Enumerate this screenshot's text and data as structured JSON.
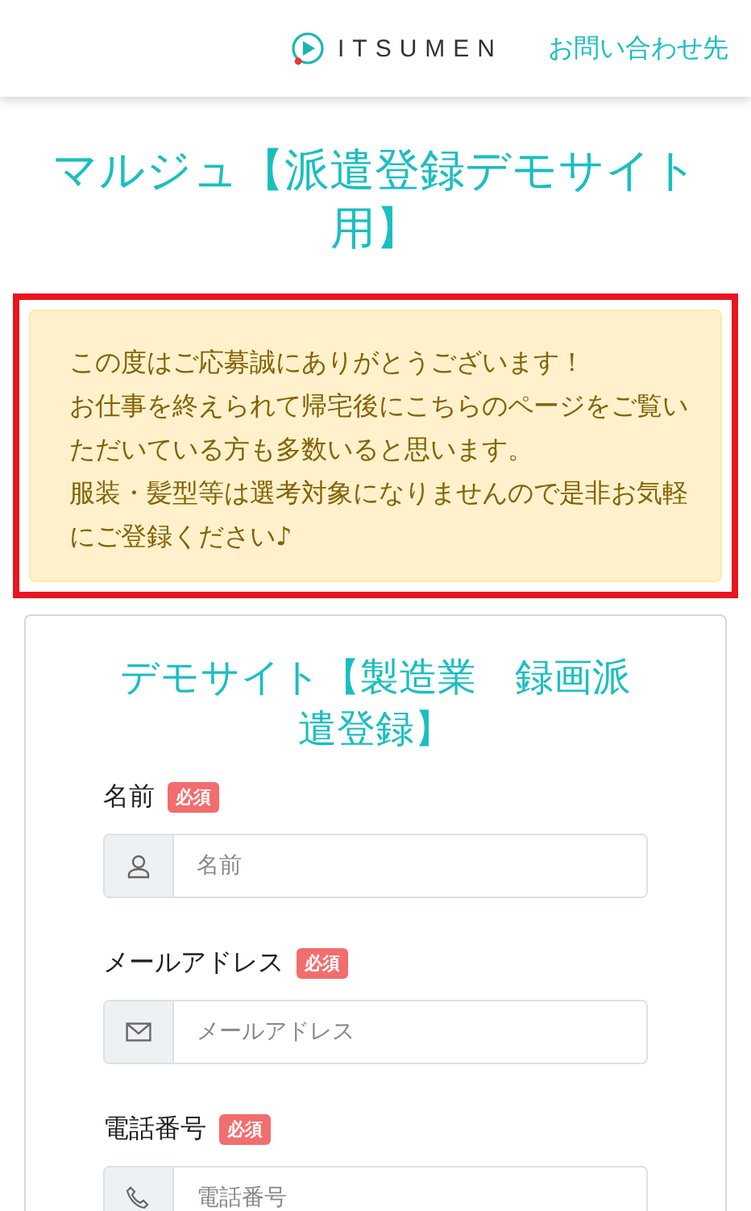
{
  "header": {
    "logo_text": "ITSUMEN",
    "contact_link": "お問い合わせ先"
  },
  "page_title": "マルジュ【派遣登録デモサイト用】",
  "notice": {
    "highlighted": true,
    "lines": [
      "この度はご応募誠にありがとうございます！",
      "お仕事を終えられて帰宅後にこちらのページをご覧いただいている方も多数いると思います。",
      "服装・髪型等は選考対象になりませんので是非お気軽にご登録ください♪"
    ]
  },
  "form": {
    "title": "デモサイト【製造業　録画派遣登録】",
    "fields": [
      {
        "kind": "name",
        "label": "名前",
        "badge": "必須",
        "placeholder": "名前"
      },
      {
        "kind": "email",
        "label": "メールアドレス",
        "badge": "必須",
        "placeholder": "メールアドレス"
      },
      {
        "kind": "phone",
        "label": "電話番号",
        "badge": "必須",
        "placeholder": "電話番号"
      }
    ]
  }
}
